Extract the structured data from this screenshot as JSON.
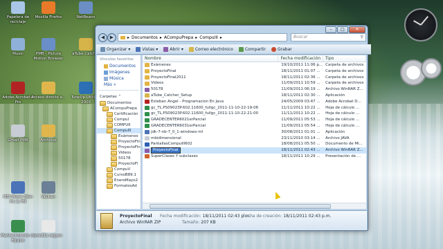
{
  "desktop_icons": [
    {
      "label": "Papelera de reciclaje",
      "color": "#a9c6e8"
    },
    {
      "label": "Mozilla Firefox",
      "color": "#e87a2a"
    },
    {
      "label": "NetBeans",
      "color": "#6b8fc4"
    },
    {
      "label": "Music",
      "color": "#8fb0d8"
    },
    {
      "label": "PMB - Picture Motion Browser",
      "color": "#6a8ec8"
    },
    {
      "label": "aTube Catcher",
      "color": "#d6b44a"
    },
    {
      "label": "Adobe Acrobat 9 Pro",
      "color": "#b22424"
    },
    {
      "label": "Acceso directo a...",
      "color": "#e0b64c"
    },
    {
      "label": "TuneUp Utilities 2009",
      "color": "#2d6fb5"
    },
    {
      "label": "Gmail PMB",
      "color": "#c8ccd4"
    },
    {
      "label": "Archivos",
      "color": "#e0b64c"
    },
    {
      "label": "MSI Mover Bien Pic & PM",
      "color": "#4a73b8"
    },
    {
      "label": "Wolkan",
      "color": "#6b7f96"
    },
    {
      "label": "Mantenimiento de Equipo",
      "color": "#3a8f4e"
    },
    {
      "label": "credito seguro",
      "color": "#e8e8e8"
    }
  ],
  "window": {
    "breadcrumb": [
      "Documentos",
      "ACompuPrepa",
      "CompuIII"
    ],
    "search_placeholder": "Buscar",
    "toolbar": [
      "Organizar",
      "Vistas",
      "Abrir",
      "Correo electrónico",
      "Compartir",
      "Grabar"
    ],
    "nav": {
      "favorites_header": "Vínculos favoritos",
      "favorites": [
        "Documentos",
        "Imágenes",
        "Música",
        "Más"
      ],
      "folders_header": "Carpetas",
      "folders": [
        "Documentos",
        "ACompuPrepa",
        "Certificación",
        "CompuI",
        "COMPUII",
        "CompuIII",
        "Exámenes",
        "ProyectoFin",
        "ProyectoFin",
        "Videos",
        "50178",
        "ProyectoFi",
        "CompuV",
        "CursoB89.1",
        "EneroMayo2",
        "FormatosAd"
      ]
    },
    "columns": [
      "Nombre",
      "Fecha modificación",
      "Tipo"
    ],
    "files": [
      {
        "name": "Exámenes",
        "date": "19/10/2011 11:06 p...",
        "type": "Carpeta de archivos",
        "icon_color": "#e2b443"
      },
      {
        "name": "ProyectoFinal",
        "date": "18/11/2011 01:07 ...",
        "type": "Carpeta de archivos",
        "icon_color": "#e2b443"
      },
      {
        "name": "ProyectoFinal2011",
        "date": "18/11/2011 02:36 ...",
        "type": "Carpeta de archivos",
        "icon_color": "#e2b443"
      },
      {
        "name": "Videos",
        "date": "11/09/2011 10:59 ...",
        "type": "Carpeta de archivos",
        "icon_color": "#e2b443"
      },
      {
        "name": "50178",
        "date": "11/09/2011 06:19 ...",
        "type": "Archivo WinRAR Z...",
        "icon_color": "#8a5ca8"
      },
      {
        "name": "aTube_Catcher_Setup",
        "date": "18/11/2011 02:30 ...",
        "type": "Aplicación",
        "icon_color": "#d6b44a"
      },
      {
        "name": "Esteban Angel - Programacion En Java",
        "date": "24/05/2009 03:47 ...",
        "type": "Adobe Acrobat D...",
        "icon_color": "#b22424"
      },
      {
        "name": "gc_TL.PS09023P.602.11600_fullgc_2011-11-10-22-19-06",
        "date": "11/11/2011 10:22 ...",
        "type": "Hoja de cálculo ...",
        "icon_color": "#2f8f4a"
      },
      {
        "name": "gc_TL.PS09023P.602.11600_fullgc_2011-11-10-22-21-00",
        "date": "11/11/2011 10:22 ...",
        "type": "Hoja de cálculo ...",
        "icon_color": "#2f8f4a"
      },
      {
        "name": "GRADECENTER6021erParcial",
        "date": "11/09/2011 05:53 ...",
        "type": "Hoja de cálculo ...",
        "icon_color": "#2f8f4a"
      },
      {
        "name": "GRADECENTER6031erParcial",
        "date": "11/09/2011 05:54 ...",
        "type": "Hoja de cálculo ...",
        "icon_color": "#2f8f4a"
      },
      {
        "name": "jdk-7-nb-7_0_1-windows-ml",
        "date": "30/08/2011 01:01 ...",
        "type": "Aplicación",
        "icon_color": "#4a73b8"
      },
      {
        "name": "mbidimensional",
        "date": "23/11/2010 03:14 ...",
        "type": "Archivo JAVA",
        "icon_color": "#c8ccd4"
      },
      {
        "name": "PantallasCompuIII602",
        "date": "18/08/2011 05:50 ...",
        "type": "Documento de Mi...",
        "icon_color": "#2d5fb5"
      },
      {
        "name": "ProyectoFinal",
        "date": "18/11/2011 02:43 ...",
        "type": "Archivo WinRAR Z...",
        "icon_color": "#8a5ca8",
        "selected": true
      },
      {
        "name": "SuperClases Y subclases",
        "date": "18/11/2011 10:29 ...",
        "type": "Presentación de ...",
        "icon_color": "#d0652a"
      }
    ],
    "details": {
      "name": "ProyectoFinal",
      "type": "Archivo WinRAR ZIP",
      "modified_label": "Fecha modificación:",
      "modified_value": "18/11/2011 02:43 p.m.",
      "created_label": "Fecha de creación:",
      "created_value": "18/11/2011 02:43 p.m.",
      "size_label": "Tamaño:",
      "size_value": "207 KB"
    }
  }
}
